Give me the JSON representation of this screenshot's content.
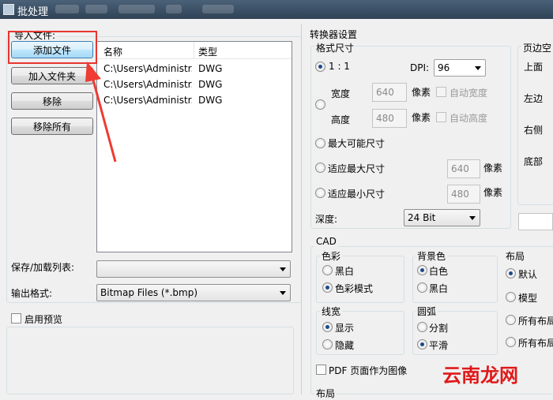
{
  "window": {
    "title": "批处理"
  },
  "import_files": {
    "legend": "导入文件:",
    "buttons": {
      "add_file": "添加文件",
      "add_folder": "加入文件夹",
      "remove": "移除",
      "remove_all": "移除所有"
    },
    "columns": [
      "名称",
      "类型"
    ],
    "rows": [
      {
        "name": "C:\\Users\\Administr...",
        "type": "DWG"
      },
      {
        "name": "C:\\Users\\Administr...",
        "type": "DWG"
      },
      {
        "name": "C:\\Users\\Administr...",
        "type": "DWG"
      }
    ]
  },
  "save_load_list": {
    "label": "保存/加载列表:",
    "value": ""
  },
  "output_format": {
    "label": "输出格式:",
    "value": "Bitmap Files (*.bmp)"
  },
  "preview": {
    "label": "启用预览",
    "checked": false
  },
  "converter_settings": {
    "legend": "转换器设置",
    "format_size": {
      "legend": "格式尺寸",
      "ratio_label": "1 : 1",
      "dpi_label": "DPI:",
      "dpi_value": "96",
      "width_label": "宽度",
      "width_value": "640",
      "height_label": "高度",
      "height_value": "480",
      "pixel_unit": "像素",
      "auto_width": "自动宽度",
      "auto_height": "自动高度",
      "max_possible": "最大可能尺寸",
      "fit_max": "适应最大尺寸",
      "fit_max_value": "640",
      "fit_min": "适应最小尺寸",
      "fit_min_value": "480",
      "depth_label": "深度:",
      "depth_value": "24 Bit"
    },
    "margins": {
      "legend": "页边空",
      "top": "上面",
      "left": "左边",
      "right": "右侧",
      "bottom": "底部"
    }
  },
  "cad": {
    "legend": "CAD",
    "color": {
      "legend": "色彩",
      "mono": "黑白",
      "color_mode": "色彩模式",
      "selected": "color_mode"
    },
    "background": {
      "legend": "背景色",
      "white": "白色",
      "black": "黑白",
      "selected": "white"
    },
    "layout": {
      "legend": "布局",
      "default": "默认",
      "model": "模型",
      "all_layouts": "所有布局",
      "all_layouts2": "所有布局",
      "selected": "default"
    },
    "line_width": {
      "legend": "线宽",
      "show": "显示",
      "hide": "隐藏",
      "selected": "show"
    },
    "arc": {
      "legend": "圆弧",
      "split": "分割",
      "smooth": "平滑",
      "selected": "smooth"
    },
    "pdf_as_image": {
      "label": "PDF 页面作为图像",
      "checked": false
    },
    "bottom_legend": "布局"
  },
  "watermark": "云南龙网",
  "colors": {
    "highlight": "#e8352e",
    "annotation_arrow": "#ee3b33",
    "watermark": "#e0191a"
  }
}
